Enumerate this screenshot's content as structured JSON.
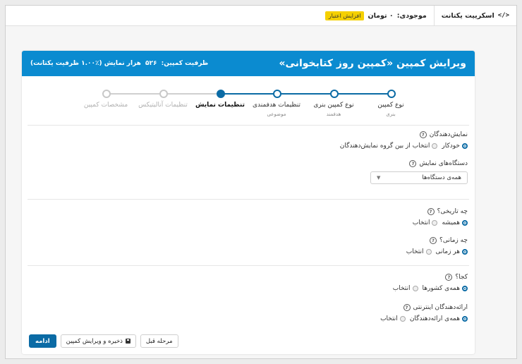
{
  "topbar": {
    "credit_label": "موجودی:",
    "credit_value": "۰ تومان",
    "increase_credit": "افزایش اعتبار",
    "script_icon": "</>",
    "script_label": "اسکریپت یکتانت"
  },
  "header": {
    "title": "ویرایش کمپین «کمپین روز کتابخوانی»",
    "capacity_label": "ظرفیت کمپین:",
    "capacity_value": "۵۲۶",
    "capacity_suffix": "هزار نمایش (٪۱.۰۰ ظرفیت یکتانت)"
  },
  "steps": [
    {
      "label": "نوع کمپین",
      "sub": "بنری",
      "state": "done"
    },
    {
      "label": "نوع کمپین بنری",
      "sub": "هدفمند",
      "state": "done"
    },
    {
      "label": "تنظیمات هدفمندی",
      "sub": "موضوعی",
      "state": "done"
    },
    {
      "label": "تنظیمات نمایش",
      "sub": "",
      "state": "active"
    },
    {
      "label": "تنظیمات آنالیتیکس",
      "sub": "",
      "state": "inactive"
    },
    {
      "label": "مشخصات کمپین",
      "sub": "",
      "state": "inactive"
    }
  ],
  "publishers": {
    "label": "نمایش‌دهندگان",
    "options": [
      "خودکار",
      "انتخاب از بین گروه نمایش‌دهندگان"
    ],
    "selected": 0
  },
  "devices": {
    "label": "دستگاه‌های نمایش",
    "selected_value": "همه‌ی دستگاه‌ها"
  },
  "when_date": {
    "label": "چه تاریخی؟",
    "options": [
      "همیشه",
      "انتخاب"
    ],
    "selected": 0
  },
  "when_time": {
    "label": "چه زمانی؟",
    "options": [
      "هر زمانی",
      "انتخاب"
    ],
    "selected": 0
  },
  "where": {
    "label": "کجا؟",
    "options": [
      "همه‌ی کشورها",
      "انتخاب"
    ],
    "selected": 0
  },
  "isp": {
    "label": "ارائه‌دهندگان اینترنتی",
    "options": [
      "همه‌ی ارائه‌دهندگان",
      "انتخاب"
    ],
    "selected": 0
  },
  "help_glyph": "?",
  "buttons": {
    "prev": "مرحله قبل",
    "save": "ذخیره و ویرایش کمپین",
    "next": "ادامه"
  },
  "colors": {
    "accent": "#0b6ba5",
    "header": "#0b8bd0",
    "credit_button": "#f5d000"
  }
}
